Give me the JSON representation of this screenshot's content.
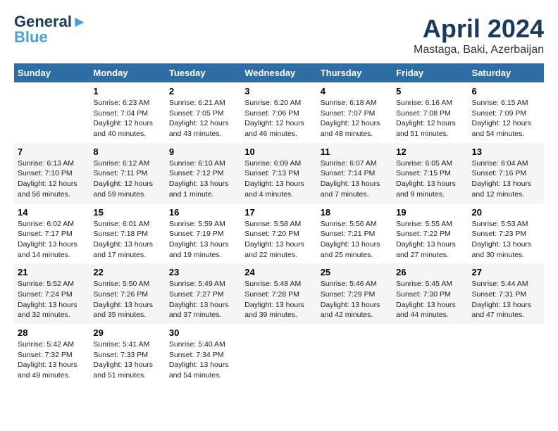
{
  "logo": {
    "line1": "General",
    "line2": "Blue"
  },
  "title": "April 2024",
  "location": "Mastaga, Baki, Azerbaijan",
  "weekdays": [
    "Sunday",
    "Monday",
    "Tuesday",
    "Wednesday",
    "Thursday",
    "Friday",
    "Saturday"
  ],
  "weeks": [
    [
      {
        "num": "",
        "sunrise": "",
        "sunset": "",
        "daylight": ""
      },
      {
        "num": "1",
        "sunrise": "Sunrise: 6:23 AM",
        "sunset": "Sunset: 7:04 PM",
        "daylight": "Daylight: 12 hours and 40 minutes."
      },
      {
        "num": "2",
        "sunrise": "Sunrise: 6:21 AM",
        "sunset": "Sunset: 7:05 PM",
        "daylight": "Daylight: 12 hours and 43 minutes."
      },
      {
        "num": "3",
        "sunrise": "Sunrise: 6:20 AM",
        "sunset": "Sunset: 7:06 PM",
        "daylight": "Daylight: 12 hours and 46 minutes."
      },
      {
        "num": "4",
        "sunrise": "Sunrise: 6:18 AM",
        "sunset": "Sunset: 7:07 PM",
        "daylight": "Daylight: 12 hours and 48 minutes."
      },
      {
        "num": "5",
        "sunrise": "Sunrise: 6:16 AM",
        "sunset": "Sunset: 7:08 PM",
        "daylight": "Daylight: 12 hours and 51 minutes."
      },
      {
        "num": "6",
        "sunrise": "Sunrise: 6:15 AM",
        "sunset": "Sunset: 7:09 PM",
        "daylight": "Daylight: 12 hours and 54 minutes."
      }
    ],
    [
      {
        "num": "7",
        "sunrise": "Sunrise: 6:13 AM",
        "sunset": "Sunset: 7:10 PM",
        "daylight": "Daylight: 12 hours and 56 minutes."
      },
      {
        "num": "8",
        "sunrise": "Sunrise: 6:12 AM",
        "sunset": "Sunset: 7:11 PM",
        "daylight": "Daylight: 12 hours and 59 minutes."
      },
      {
        "num": "9",
        "sunrise": "Sunrise: 6:10 AM",
        "sunset": "Sunset: 7:12 PM",
        "daylight": "Daylight: 13 hours and 1 minute."
      },
      {
        "num": "10",
        "sunrise": "Sunrise: 6:09 AM",
        "sunset": "Sunset: 7:13 PM",
        "daylight": "Daylight: 13 hours and 4 minutes."
      },
      {
        "num": "11",
        "sunrise": "Sunrise: 6:07 AM",
        "sunset": "Sunset: 7:14 PM",
        "daylight": "Daylight: 13 hours and 7 minutes."
      },
      {
        "num": "12",
        "sunrise": "Sunrise: 6:05 AM",
        "sunset": "Sunset: 7:15 PM",
        "daylight": "Daylight: 13 hours and 9 minutes."
      },
      {
        "num": "13",
        "sunrise": "Sunrise: 6:04 AM",
        "sunset": "Sunset: 7:16 PM",
        "daylight": "Daylight: 13 hours and 12 minutes."
      }
    ],
    [
      {
        "num": "14",
        "sunrise": "Sunrise: 6:02 AM",
        "sunset": "Sunset: 7:17 PM",
        "daylight": "Daylight: 13 hours and 14 minutes."
      },
      {
        "num": "15",
        "sunrise": "Sunrise: 6:01 AM",
        "sunset": "Sunset: 7:18 PM",
        "daylight": "Daylight: 13 hours and 17 minutes."
      },
      {
        "num": "16",
        "sunrise": "Sunrise: 5:59 AM",
        "sunset": "Sunset: 7:19 PM",
        "daylight": "Daylight: 13 hours and 19 minutes."
      },
      {
        "num": "17",
        "sunrise": "Sunrise: 5:58 AM",
        "sunset": "Sunset: 7:20 PM",
        "daylight": "Daylight: 13 hours and 22 minutes."
      },
      {
        "num": "18",
        "sunrise": "Sunrise: 5:56 AM",
        "sunset": "Sunset: 7:21 PM",
        "daylight": "Daylight: 13 hours and 25 minutes."
      },
      {
        "num": "19",
        "sunrise": "Sunrise: 5:55 AM",
        "sunset": "Sunset: 7:22 PM",
        "daylight": "Daylight: 13 hours and 27 minutes."
      },
      {
        "num": "20",
        "sunrise": "Sunrise: 5:53 AM",
        "sunset": "Sunset: 7:23 PM",
        "daylight": "Daylight: 13 hours and 30 minutes."
      }
    ],
    [
      {
        "num": "21",
        "sunrise": "Sunrise: 5:52 AM",
        "sunset": "Sunset: 7:24 PM",
        "daylight": "Daylight: 13 hours and 32 minutes."
      },
      {
        "num": "22",
        "sunrise": "Sunrise: 5:50 AM",
        "sunset": "Sunset: 7:26 PM",
        "daylight": "Daylight: 13 hours and 35 minutes."
      },
      {
        "num": "23",
        "sunrise": "Sunrise: 5:49 AM",
        "sunset": "Sunset: 7:27 PM",
        "daylight": "Daylight: 13 hours and 37 minutes."
      },
      {
        "num": "24",
        "sunrise": "Sunrise: 5:48 AM",
        "sunset": "Sunset: 7:28 PM",
        "daylight": "Daylight: 13 hours and 39 minutes."
      },
      {
        "num": "25",
        "sunrise": "Sunrise: 5:46 AM",
        "sunset": "Sunset: 7:29 PM",
        "daylight": "Daylight: 13 hours and 42 minutes."
      },
      {
        "num": "26",
        "sunrise": "Sunrise: 5:45 AM",
        "sunset": "Sunset: 7:30 PM",
        "daylight": "Daylight: 13 hours and 44 minutes."
      },
      {
        "num": "27",
        "sunrise": "Sunrise: 5:44 AM",
        "sunset": "Sunset: 7:31 PM",
        "daylight": "Daylight: 13 hours and 47 minutes."
      }
    ],
    [
      {
        "num": "28",
        "sunrise": "Sunrise: 5:42 AM",
        "sunset": "Sunset: 7:32 PM",
        "daylight": "Daylight: 13 hours and 49 minutes."
      },
      {
        "num": "29",
        "sunrise": "Sunrise: 5:41 AM",
        "sunset": "Sunset: 7:33 PM",
        "daylight": "Daylight: 13 hours and 51 minutes."
      },
      {
        "num": "30",
        "sunrise": "Sunrise: 5:40 AM",
        "sunset": "Sunset: 7:34 PM",
        "daylight": "Daylight: 13 hours and 54 minutes."
      },
      {
        "num": "",
        "sunrise": "",
        "sunset": "",
        "daylight": ""
      },
      {
        "num": "",
        "sunrise": "",
        "sunset": "",
        "daylight": ""
      },
      {
        "num": "",
        "sunrise": "",
        "sunset": "",
        "daylight": ""
      },
      {
        "num": "",
        "sunrise": "",
        "sunset": "",
        "daylight": ""
      }
    ]
  ]
}
